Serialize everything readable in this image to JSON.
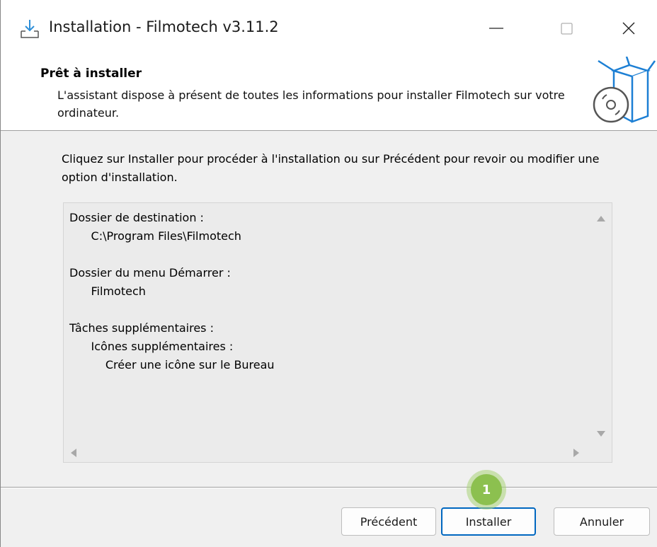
{
  "window": {
    "title": "Installation - Filmotech v3.11.2",
    "accent_color": "#0067c0",
    "icons": {
      "app": "download-install-icon",
      "minimize": "minimize-icon",
      "maximize": "maximize-icon",
      "close": "close-icon"
    }
  },
  "header": {
    "title": "Prêt à installer",
    "description": "L'assistant dispose à présent de toutes les informations pour installer Filmotech sur votre ordinateur.",
    "image_icon": "software-box-cd-icon"
  },
  "body": {
    "intro": "Cliquez sur Installer pour procéder à l'installation ou sur Précédent pour revoir ou modifier une option d'installation.",
    "summary_lines": [
      "Dossier de destination :",
      "      C:\\Program Files\\Filmotech",
      "",
      "Dossier du menu Démarrer :",
      "      Filmotech",
      "",
      "Tâches supplémentaires :",
      "      Icônes supplémentaires :",
      "          Créer une icône sur le Bureau"
    ]
  },
  "buttons": {
    "previous": "Précédent",
    "install": "Installer",
    "cancel": "Annuler"
  },
  "annotation": {
    "step_number": "1",
    "color": "#8cc04f"
  }
}
